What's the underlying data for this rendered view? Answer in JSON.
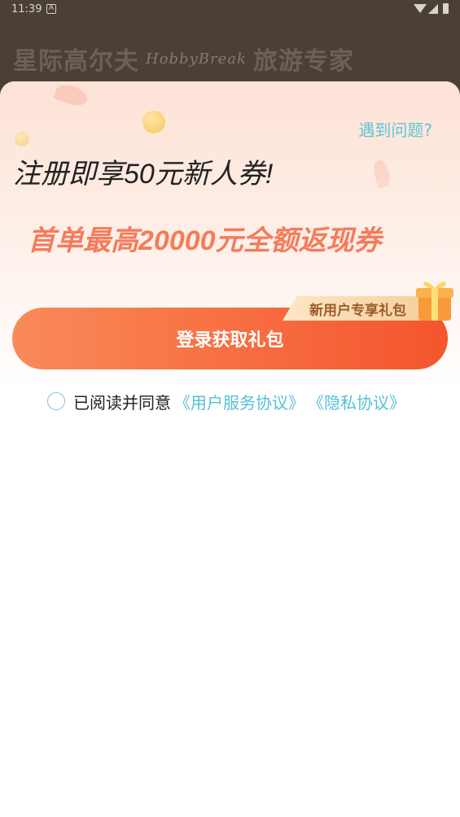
{
  "status_bar": {
    "time": "11:39",
    "notification_icon": "A"
  },
  "brand": {
    "name": "星际高尔夫",
    "script_text": "HobbyBreak",
    "tagline": "旅游专家"
  },
  "sheet": {
    "help_link": "遇到问题?",
    "headline": "注册即享50元新人券!",
    "subline": "首单最高20000元全额返现券",
    "gift_tag": "新用户专享礼包",
    "login_button": "登录获取礼包",
    "agreement": {
      "prefix": "已阅读并同意",
      "user_agreement": "《用户服务协议》",
      "privacy_agreement": "《隐私协议》",
      "checked": false
    }
  },
  "colors": {
    "accent": "#f76a3e",
    "link": "#55c0d6",
    "highlight_text": "#f47c5c"
  }
}
